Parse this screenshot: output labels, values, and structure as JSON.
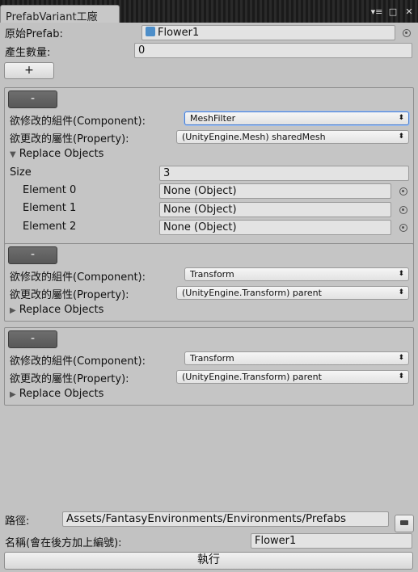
{
  "window": {
    "tab_title": "PrefabVariant工廠",
    "menu_icon": "≡",
    "controls": [
      "▾≡",
      "□",
      "✕"
    ]
  },
  "top": {
    "source_prefab_label": "原始Prefab:",
    "source_prefab_value": "Flower1",
    "count_label": "產生數量:",
    "count_value": "0",
    "add_button": "+"
  },
  "blocks": [
    {
      "remove_button": "-",
      "component_label": "欲修改的組件(Component):",
      "component_value": "MeshFilter",
      "property_label": "欲更改的屬性(Property):",
      "property_value": "(UnityEngine.Mesh) sharedMesh",
      "replace_label": "Replace Objects",
      "expanded": true,
      "size_label": "Size",
      "size_value": "3",
      "elements": [
        {
          "label": "Element 0",
          "value": "None (Object)"
        },
        {
          "label": "Element 1",
          "value": "None (Object)"
        },
        {
          "label": "Element 2",
          "value": "None (Object)"
        }
      ]
    },
    {
      "remove_button": "-",
      "component_label": "欲修改的組件(Component):",
      "component_value": "Transform",
      "property_label": "欲更改的屬性(Property):",
      "property_value": "(UnityEngine.Transform) parent",
      "replace_label": "Replace Objects",
      "expanded": false
    },
    {
      "remove_button": "-",
      "component_label": "欲修改的組件(Component):",
      "component_value": "Transform",
      "property_label": "欲更改的屬性(Property):",
      "property_value": "(UnityEngine.Transform) parent",
      "replace_label": "Replace Objects",
      "expanded": false
    }
  ],
  "bottom": {
    "path_label": "路徑:",
    "path_value": "Assets/FantasyEnvironments/Environments/Prefabs",
    "name_label": "名稱(會在後方加上編號):",
    "name_value": "Flower1",
    "execute_button": "執行"
  },
  "colors": {
    "background": "#c2c2c2",
    "accent": "#4a7fd1"
  }
}
